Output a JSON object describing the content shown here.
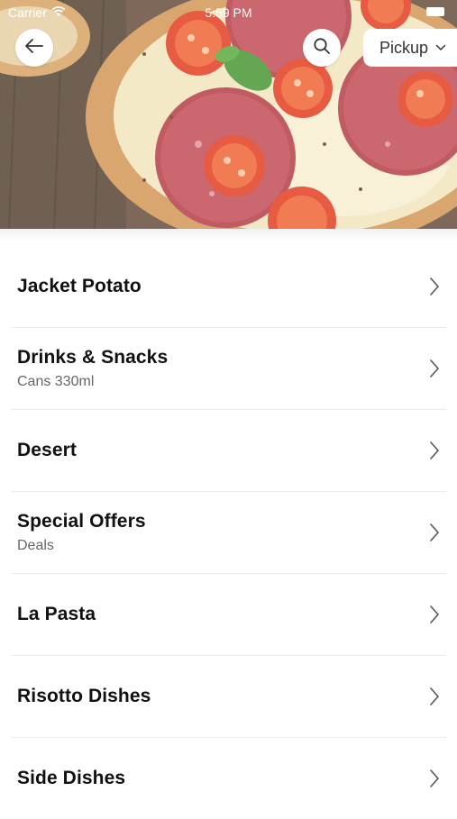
{
  "status_bar": {
    "carrier": "Carrier",
    "time": "5:59 PM",
    "wifi_icon": "wifi-icon",
    "battery_icon": "battery-icon"
  },
  "header": {
    "back_icon": "arrow-left-icon",
    "search_icon": "search-icon",
    "order_mode": "Pickup",
    "order_mode_icon": "chevron-down-icon"
  },
  "menu": {
    "items": [
      {
        "title": "Jacket Potato",
        "subtitle": ""
      },
      {
        "title": "Drinks & Snacks",
        "subtitle": "Cans 330ml"
      },
      {
        "title": "Desert",
        "subtitle": ""
      },
      {
        "title": "Special Offers",
        "subtitle": "Deals"
      },
      {
        "title": "La Pasta",
        "subtitle": ""
      },
      {
        "title": "Risotto Dishes",
        "subtitle": ""
      },
      {
        "title": "Side Dishes",
        "subtitle": ""
      }
    ],
    "row_icon": "chevron-right-icon"
  },
  "colors": {
    "title_text": "#111111",
    "subtitle_text": "#666666",
    "divider": "#ececec",
    "button_bg": "#ffffff"
  }
}
